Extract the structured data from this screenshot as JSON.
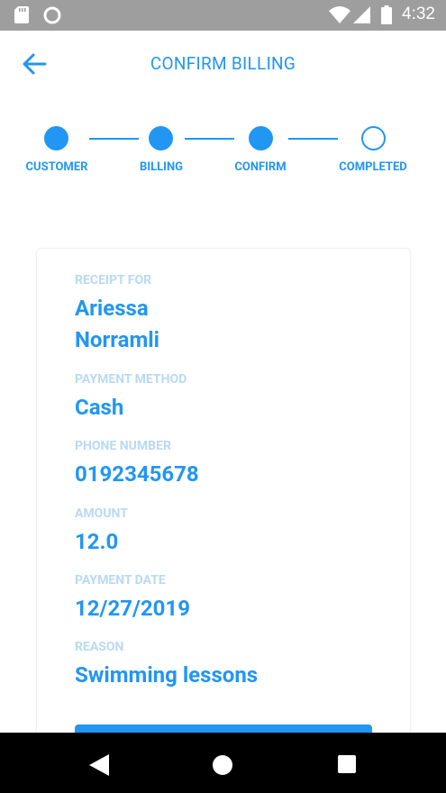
{
  "status_bar": {
    "time": "4:32",
    "icons": [
      "sd-card-icon",
      "circle-notification-icon",
      "wifi-icon",
      "cell-signal-icon",
      "battery-icon"
    ]
  },
  "header": {
    "title": "CONFIRM BILLING",
    "back_icon": "arrow-back-icon"
  },
  "stepper": {
    "steps": [
      {
        "label": "CUSTOMER",
        "state": "done"
      },
      {
        "label": "BILLING",
        "state": "done"
      },
      {
        "label": "CONFIRM",
        "state": "done"
      },
      {
        "label": "COMPLETED",
        "state": "pending"
      }
    ]
  },
  "receipt": {
    "receipt_for_label": "RECEIPT FOR",
    "name_line1": "Ariessa",
    "name_line2": "Norramli",
    "payment_method_label": "PAYMENT METHOD",
    "payment_method": "Cash",
    "phone_label": "PHONE NUMBER",
    "phone": "0192345678",
    "amount_label": "AMOUNT",
    "amount": "12.0",
    "payment_date_label": "PAYMENT DATE",
    "payment_date": "12/27/2019",
    "reason_label": "REASON",
    "reason": "Swimming lessons"
  },
  "colors": {
    "accent": "#2196f3",
    "label": "#b9d9f3",
    "status_bar": "#9e9e9e",
    "nav_bar": "#000000"
  },
  "nav_bar": {
    "icons": [
      "nav-back-icon",
      "nav-home-icon",
      "nav-recents-icon"
    ]
  }
}
